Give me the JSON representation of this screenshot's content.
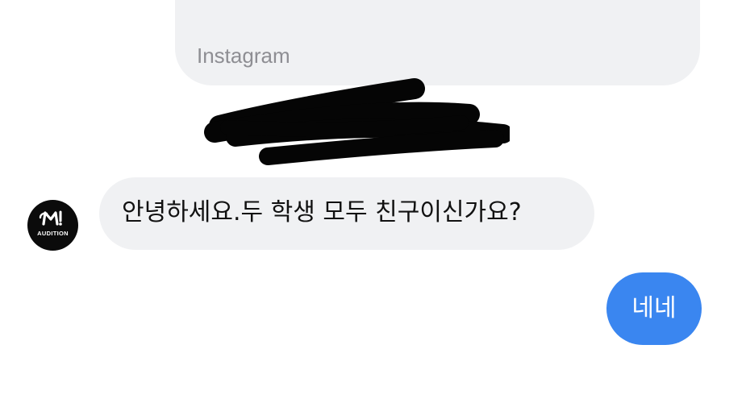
{
  "thread": {
    "header_bubble_text": "Instagram",
    "redaction_icon": "redaction-scribble",
    "incoming": {
      "sender_avatar_text": "AUDITION",
      "sender_avatar_icon": "sm-logo-icon",
      "message": "안녕하세요.두 학생 모두 친구이신가요?"
    },
    "outgoing": {
      "message": "네네"
    }
  },
  "colors": {
    "background": "#ffffff",
    "incoming_bubble": "#f0f1f3",
    "outgoing_bubble": "#3a86f0",
    "incoming_text": "#111111",
    "meta_text": "#8e8e93"
  }
}
